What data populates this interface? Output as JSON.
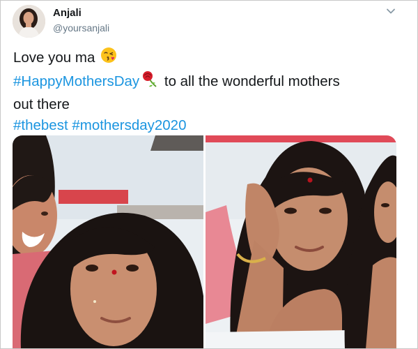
{
  "user": {
    "display_name": "Anjali",
    "handle": "@yoursanjali"
  },
  "tweet": {
    "line1_text": "Love you ma",
    "line1_emoji": "face-throwing-a-kiss",
    "line2_hashtag": "#HappyMothersDay",
    "line2_emoji": "rose",
    "line2_text": " to all the wonderful mothers",
    "line3_text": "out there",
    "hashtags": [
      "#thebest",
      "#mothersday2020"
    ]
  },
  "media": {
    "photos": [
      {
        "subject": "selfie-daughter-and-mother"
      },
      {
        "subject": "mother-resting-chin-on-hand"
      }
    ]
  },
  "colors": {
    "link": "#1b95e0",
    "text": "#14171a",
    "muted": "#657786"
  },
  "icons": {
    "menu": "chevron-down-icon"
  }
}
